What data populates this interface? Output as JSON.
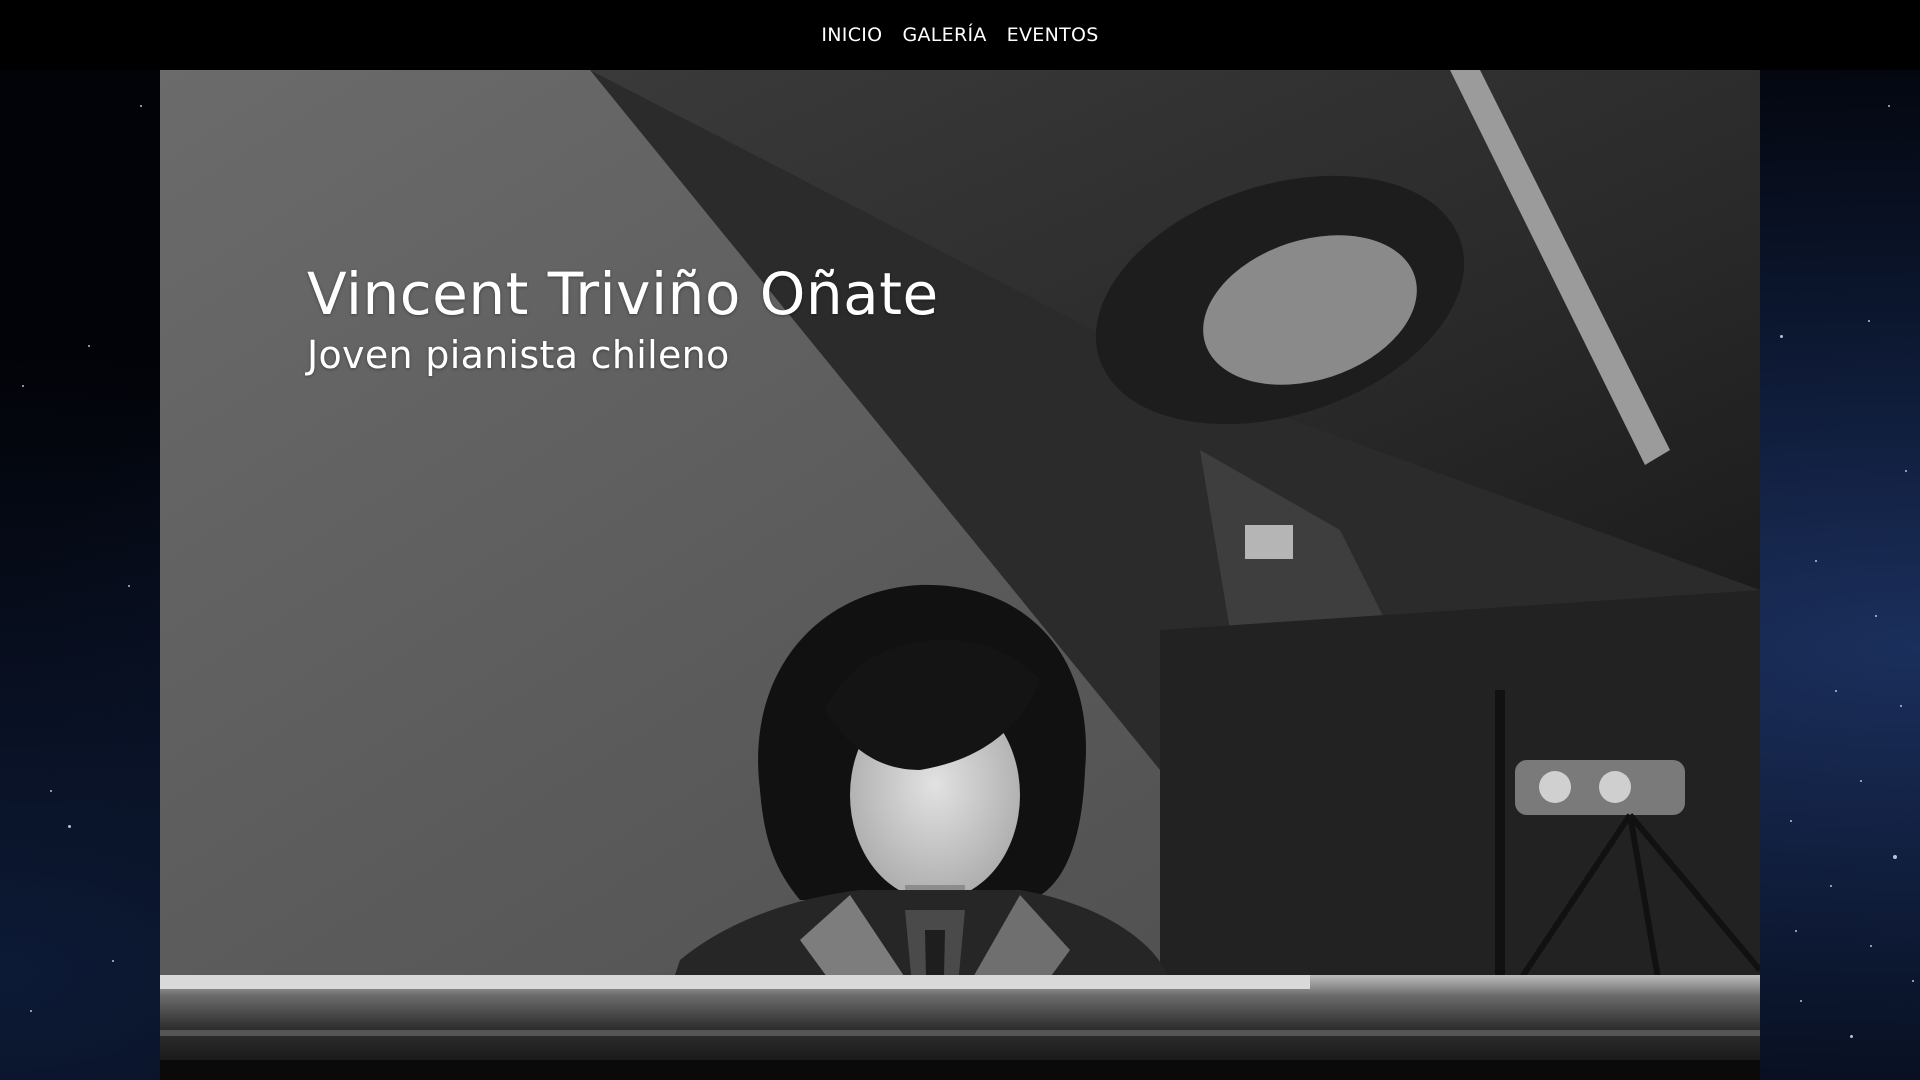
{
  "nav": {
    "items": [
      {
        "label": "INICIO"
      },
      {
        "label": "GALERÍA"
      },
      {
        "label": "EVENTOS"
      }
    ]
  },
  "hero": {
    "title": "Vincent Triviño Oñate",
    "subtitle": "Joven pianista chileno",
    "photo_icon": "pianist-photo"
  },
  "colors": {
    "nav_background": "#000000",
    "nav_text": "#ffffff",
    "page_background": "#020308",
    "hero_text": "#ffffff"
  }
}
